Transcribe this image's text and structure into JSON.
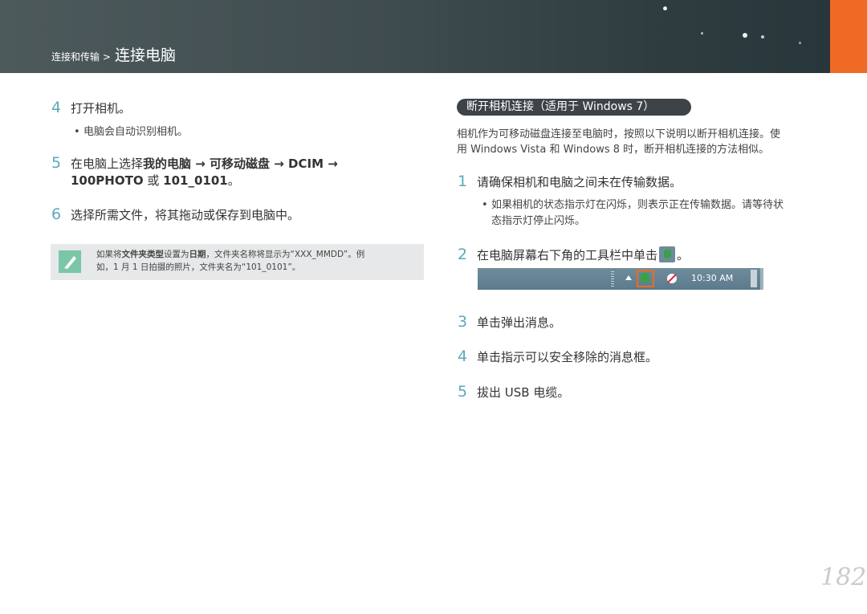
{
  "header": {
    "breadcrumb_parent": "连接和传输 >",
    "breadcrumb_current": "连接电脑"
  },
  "colors": {
    "accent_orange": "#ef6a22",
    "step_number": "#5aa9b8",
    "header_bg": "#3f4c4f"
  },
  "left": {
    "step4": {
      "num": "4",
      "text": "打开相机。"
    },
    "step4_bullet": "电脑会自动识别相机。",
    "step5": {
      "num": "5",
      "line1_a": "在电脑上选择",
      "line1_b": "我的电脑 → 可移动磁盘 → DCIM →",
      "line2_b": "100PHOTO",
      "line2_c": " 或 ",
      "line2_d": "101_0101",
      "line2_e": "。"
    },
    "step6": {
      "num": "6",
      "text": "选择所需文件，将其拖动或保存到电脑中。"
    },
    "note": {
      "icon": "pen-note-icon",
      "a": "如果将",
      "b": "文件夹类型",
      "c": "设置为",
      "d": "日期",
      "e": "，文件夹名称将显示为“XXX_MMDD”。例",
      "f": "如，1 月 1 日拍摄的照片，文件夹名为“101_0101”。"
    }
  },
  "right": {
    "section_title": "断开相机连接（适用于 Windows 7）",
    "intro_line1": "相机作为可移动磁盘连接至电脑时，按照以下说明以断开相机连接。使",
    "intro_line2": "用 Windows Vista 和 Windows 8 时，断开相机连接的方法相似。",
    "step1": {
      "num": "1",
      "text": "请确保相机和电脑之间未在传输数据。"
    },
    "step1_bullet_1": "如果相机的状态指示灯在闪烁，则表示正在传输数据。请等待状",
    "step1_bullet_2": "态指示灯停止闪烁。",
    "step2": {
      "num": "2",
      "text_a": "在电脑屏幕右下角的工具栏中单击",
      "text_b": "。"
    },
    "taskbar": {
      "time": "10:30 AM"
    },
    "step3": {
      "num": "3",
      "text": "单击弹出消息。"
    },
    "step4": {
      "num": "4",
      "text": "单击指示可以安全移除的消息框。"
    },
    "step5": {
      "num": "5",
      "text": "拔出 USB 电缆。"
    }
  },
  "page_number": "182"
}
